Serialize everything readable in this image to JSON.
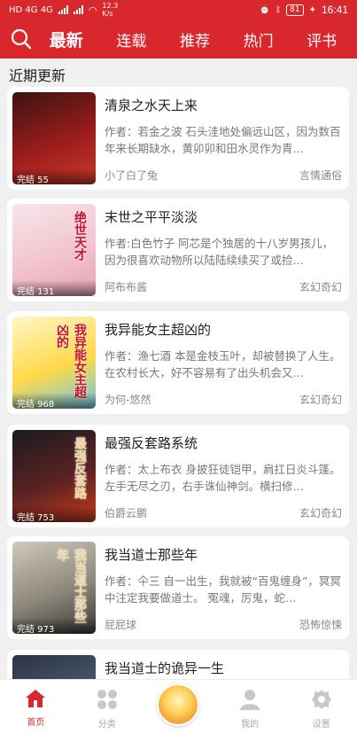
{
  "status_bar": {
    "left_text": "HD 4G 4G",
    "speed": "12.3 K/s",
    "battery": "81",
    "time": "16:41"
  },
  "top_nav": {
    "tabs": [
      {
        "label": "最新",
        "active": true
      },
      {
        "label": "连载",
        "active": false
      },
      {
        "label": "推荐",
        "active": false
      },
      {
        "label": "热门",
        "active": false
      },
      {
        "label": "评书",
        "active": false
      }
    ]
  },
  "section": {
    "title": "近期更新"
  },
  "books": [
    {
      "title": "清泉之水天上来",
      "desc": "作者：若金之波 石头洼地处偏远山区，因为数百年来长期缺水，黄卯卯和田水灵作为青…",
      "author": "小了白了兔",
      "genre": "言情通俗",
      "badge": "完结 55",
      "cover_colors": [
        "#3a1410",
        "#9b1c1c",
        "#c93a2a"
      ]
    },
    {
      "title": "末世之平平淡淡",
      "desc": "作者:白色竹子 阿芯是个独居的十八岁男孩儿，因为很喜欢动物所以陆陆续续买了或捡…",
      "author": "阿布布酱",
      "genre": "玄幻奇幻",
      "badge": "完结 131",
      "cover_colors": [
        "#f7e6ea",
        "#f2c4cf",
        "#e7a3b3"
      ],
      "cover_text": "绝世天才"
    },
    {
      "title": "我异能女主超凶的",
      "desc": "作者：渔七酒 本是金枝玉叶，却被替换了人生。在农村长大，好不容易有了出头机会又…",
      "author": "为何-悠然",
      "genre": "玄幻奇幻",
      "badge": "完结 968",
      "cover_colors": [
        "#fff6c9",
        "#ffd94a",
        "#6cc6e8"
      ],
      "cover_text": "我异能女主超凶的"
    },
    {
      "title": "最强反套路系统",
      "desc": "作者：太上布衣 身披狂徒铠甲，肩扛日炎斗篷。左手无尽之刃，右手诛仙神剑。横扫修…",
      "author": "伯爵云鹏",
      "genre": "玄幻奇幻",
      "badge": "完结 753",
      "cover_colors": [
        "#1b1b1f",
        "#5a2222",
        "#c53a1e"
      ],
      "cover_text": "最强反套路"
    },
    {
      "title": "我当道士那些年",
      "desc": "作者：仐三 自一出生，我就被“百鬼缠身”，冥冥中注定我要做道士。 冤魂，厉鬼，蛇…",
      "author": "屁屁球",
      "genre": "恐怖惊悚",
      "badge": "完结 973",
      "cover_colors": [
        "#cfc9bd",
        "#8d877c",
        "#3b3a36"
      ],
      "cover_text": "我当道士那些年"
    },
    {
      "title": "我当道士的诡异一生",
      "desc": "",
      "author": "",
      "genre": "",
      "badge": "",
      "cover_colors": [
        "#2b3444",
        "#4c5a70",
        "#8692a6"
      ]
    }
  ],
  "bottom_nav": [
    {
      "label": "首页",
      "icon": "home-icon",
      "active": true
    },
    {
      "label": "分类",
      "icon": "category-icon",
      "active": false
    },
    {
      "label": "",
      "icon": "avatar",
      "active": false
    },
    {
      "label": "我的",
      "icon": "user-icon",
      "active": false
    },
    {
      "label": "设置",
      "icon": "settings-icon",
      "active": false
    }
  ],
  "colors": {
    "brand": "#d8272d",
    "muted_icon": "#c8c8c8"
  }
}
